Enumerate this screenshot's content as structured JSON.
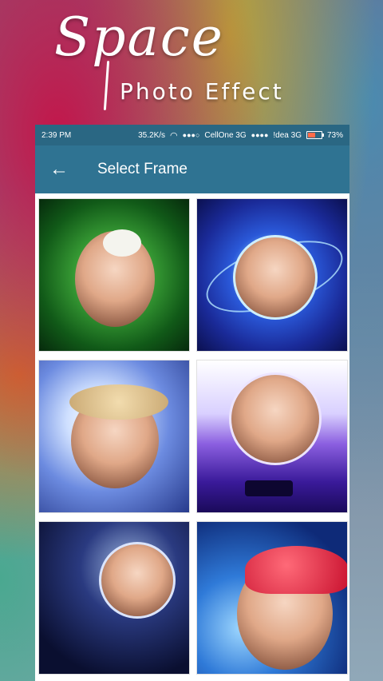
{
  "promo": {
    "title_script": "Space",
    "title_sub": "Photo Effect"
  },
  "status_bar": {
    "time": "2:39 PM",
    "speed": "35.2K/s",
    "carrier1": "CellOne 3G",
    "carrier2": "!dea 3G",
    "battery": "73%",
    "signal_dots1": "●●●○",
    "signal_dots2": "●●●●",
    "wifi_icon": "wifi-icon",
    "battery_icon": "battery-icon"
  },
  "app_bar": {
    "back_icon": "←",
    "title": "Select Frame"
  },
  "colors": {
    "status_bar": "#2a6783",
    "app_bar": "#2f7392",
    "battery_fill": "#ff6b4a"
  },
  "frames": [
    {
      "id": "frame-1",
      "theme": "green-burst"
    },
    {
      "id": "frame-2",
      "theme": "blue-galaxy-spiral"
    },
    {
      "id": "frame-3",
      "theme": "sparkle-swirl"
    },
    {
      "id": "frame-4",
      "theme": "purple-planet-couple"
    },
    {
      "id": "frame-5",
      "theme": "deep-space-planet"
    },
    {
      "id": "frame-6",
      "theme": "blue-earth"
    }
  ]
}
